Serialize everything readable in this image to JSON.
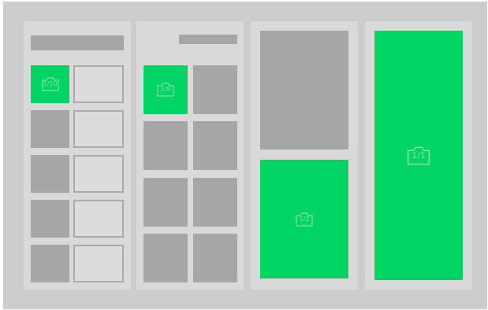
{
  "colors": {
    "background": "#cccccc",
    "panel": "#d9d9d9",
    "placeholder": "#a6a6a6",
    "accent": "#00d563",
    "badge": "#7ce3a6"
  },
  "badges": {
    "panel1": "1/10",
    "panel2": "1/8",
    "panel3": "1/2",
    "panel4": "1/1"
  },
  "icons": {
    "photo_badge": "camera-icon"
  }
}
